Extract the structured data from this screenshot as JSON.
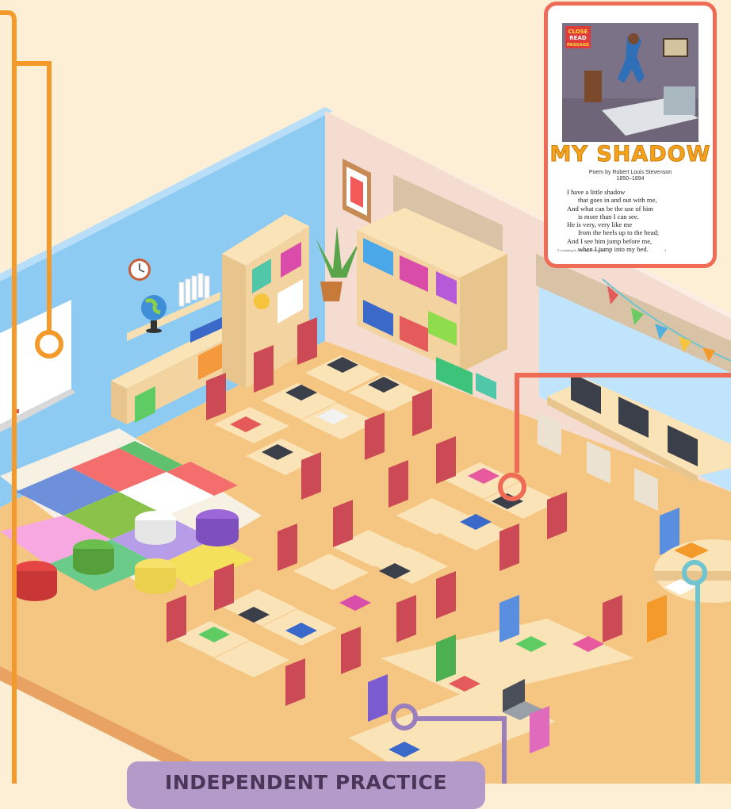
{
  "colors": {
    "background": "#fcefd6",
    "wall_blue": "#8ecbf3",
    "wall_pink": "#f4dcd0",
    "floor": "#f4c682",
    "orange_callout": "#f39a2a",
    "red_callout": "#ef6b55",
    "teal_callout": "#6ec4d0",
    "purple_callout": "#9a7fbe",
    "chair_red": "#cc4a55",
    "desk": "#fbe3b8"
  },
  "passage_card": {
    "badge_lines": [
      "CLOSE",
      "READ",
      "PASSAGE"
    ],
    "title": "MY SHADOW",
    "author": "Poem by Robert Louis Stevenson",
    "years": "1850–1894",
    "poem_lines": [
      {
        "text": "I have a little shadow",
        "indent": false
      },
      {
        "text": "that goes in and out with me,",
        "indent": true
      },
      {
        "text": "And what can be the use of him",
        "indent": false
      },
      {
        "text": "is more than I can see.",
        "indent": true
      },
      {
        "text": "He is very, very like me",
        "indent": false
      },
      {
        "text": "from the heels up to the head;",
        "indent": true
      },
      {
        "text": "And I see him jump before me,",
        "indent": false
      },
      {
        "text": "when I jump into my bed.",
        "indent": true
      }
    ],
    "copyright": "© Learning A–Z  All rights reserved.",
    "page_number": "1"
  },
  "banner": {
    "label": "INDEPENDENT PRACTICE"
  },
  "icons": [
    "clock-icon",
    "globe-icon",
    "plant-icon",
    "laptop-icon",
    "monitor-icon",
    "pennant-icon"
  ]
}
